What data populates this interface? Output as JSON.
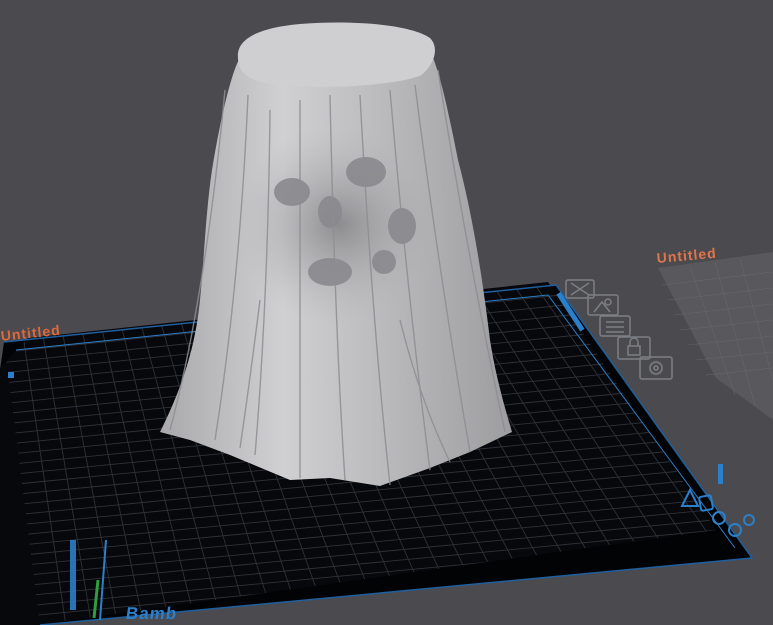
{
  "scene": {
    "plates": [
      {
        "label": "Untitled"
      },
      {
        "label": "Untitled"
      }
    ],
    "brand_text": "Bamb",
    "plate_toolbar": {
      "buttons": [
        {
          "icon": "close-icon"
        },
        {
          "icon": "auto-orient-icon"
        },
        {
          "icon": "arrange-icon"
        },
        {
          "icon": "lock-icon"
        },
        {
          "icon": "settings-icon"
        }
      ]
    },
    "model": {
      "name": "veiled-skull-model"
    },
    "colors": {
      "background": "#4b4b4f",
      "plate_surface": "#050608",
      "plate_grid": "#3a3c44",
      "accent_blue": "#2c7fc9",
      "label_orange": "#e0683a",
      "model_gray": "#c2c2c4"
    }
  }
}
